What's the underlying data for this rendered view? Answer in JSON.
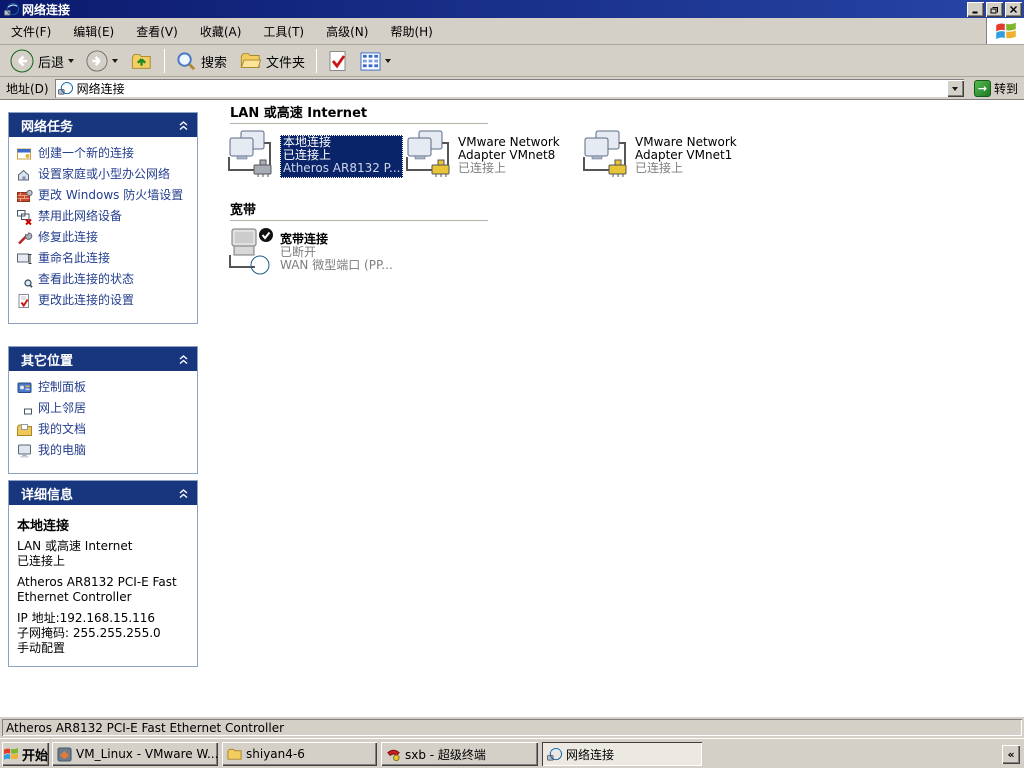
{
  "window": {
    "title": "网络连接"
  },
  "menu": {
    "items": [
      "文件(F)",
      "编辑(E)",
      "查看(V)",
      "收藏(A)",
      "工具(T)",
      "高级(N)",
      "帮助(H)"
    ]
  },
  "toolbar": {
    "back_label": "后退",
    "search_label": "搜索",
    "folders_label": "文件夹"
  },
  "address": {
    "label": "地址(D)",
    "value": "网络连接",
    "go_label": "转到"
  },
  "sidebar": {
    "tasks": {
      "title": "网络任务",
      "items": [
        "创建一个新的连接",
        "设置家庭或小型办公网络",
        "更改 Windows 防火墙设置",
        "禁用此网络设备",
        "修复此连接",
        "重命名此连接",
        "查看此连接的状态",
        "更改此连接的设置"
      ]
    },
    "places": {
      "title": "其它位置",
      "items": [
        "控制面板",
        "网上邻居",
        "我的文档",
        "我的电脑"
      ]
    },
    "details": {
      "title": "详细信息",
      "name": "本地连接",
      "type": "LAN 或高速 Internet",
      "status": "已连接上",
      "device": "Atheros AR8132 PCI-E Fast Ethernet Controller",
      "ip": "IP 地址:192.168.15.116",
      "mask": "子网掩码: 255.255.255.0",
      "config": "手动配置"
    }
  },
  "main": {
    "groups": [
      {
        "title": "LAN 或高速 Internet",
        "connections": [
          {
            "name": "本地连接",
            "status": "已连接上",
            "device": "Atheros AR8132 P..."
          },
          {
            "name": "VMware Network Adapter VMnet8",
            "status": "已连接上"
          },
          {
            "name": "VMware Network Adapter VMnet1",
            "status": "已连接上"
          }
        ]
      },
      {
        "title": "宽带",
        "connections": [
          {
            "name": "宽带连接",
            "status": "已断开",
            "device": "WAN 微型端口 (PP..."
          }
        ]
      }
    ]
  },
  "statusbar": {
    "text": "Atheros AR8132 PCI-E Fast Ethernet Controller"
  },
  "taskbar": {
    "start_label": "开始",
    "buttons": [
      "VM_Linux - VMware W...",
      "shiyan4-6",
      "sxb - 超级终端",
      "网络连接"
    ],
    "overflow": "«"
  }
}
